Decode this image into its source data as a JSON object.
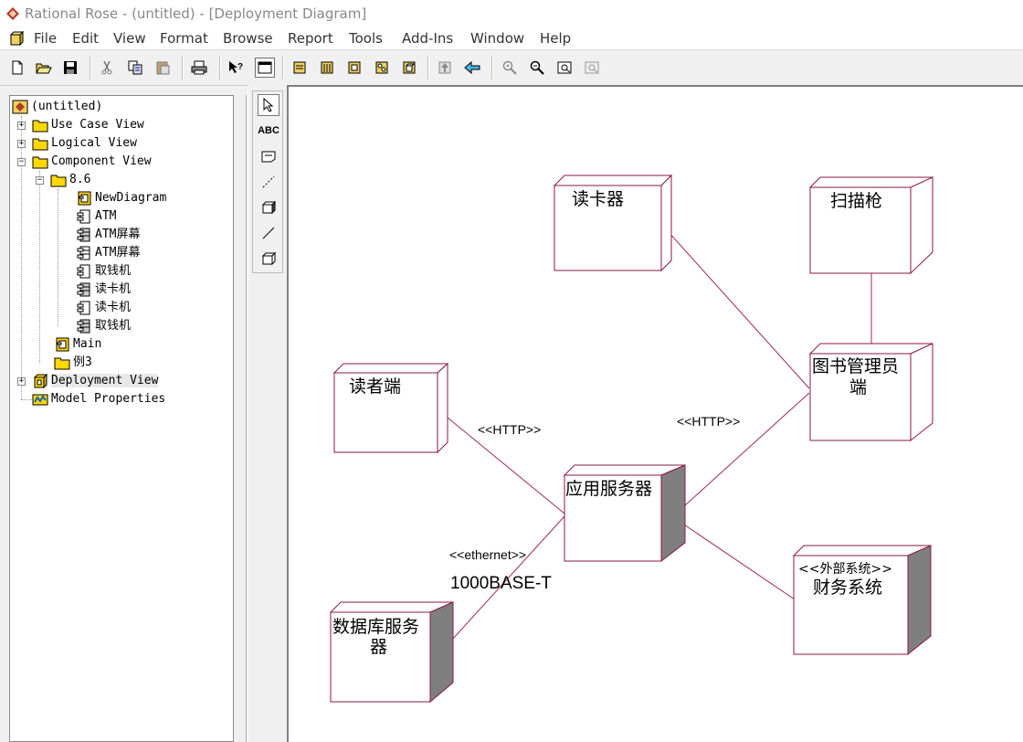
{
  "window": {
    "title": "Rational Rose - (untitled) - [Deployment Diagram]"
  },
  "menu": [
    "File",
    "Edit",
    "View",
    "Format",
    "Browse",
    "Report",
    "Tools",
    "Add-Ins",
    "Window",
    "Help"
  ],
  "browser": {
    "root": "(untitled)",
    "use_case_view": "Use Case View",
    "logical_view": "Logical View",
    "component_view": "Component View",
    "package_86": "8.6",
    "new_diagram": "NewDiagram",
    "comp_atm": "ATM",
    "comp_atm_screen_1": "ATM屏幕",
    "comp_atm_screen_2": "ATM屏幕",
    "comp_withdraw_1": "取钱机",
    "comp_card_reader_1": "读卡机",
    "comp_card_reader_2": "读卡机",
    "comp_withdraw_2": "取钱机",
    "main": "Main",
    "example3": "例3",
    "deployment_view": "Deployment View",
    "model_properties": "Model Properties"
  },
  "palette": {
    "text_tool": "ABC"
  },
  "diagram": {
    "nodes": {
      "card_reader": "读卡器",
      "scanner": "扫描枪",
      "reader_client_line1": "读者端",
      "librarian_line1": "图书管理员",
      "librarian_line2": "端",
      "app_server": "应用服务器",
      "db_server_line1": "数据库服务",
      "db_server_line2": "器",
      "finance_stereotype": "<<外部系统>>",
      "finance": "财务系统"
    },
    "connections": {
      "http_left": "<<HTTP>>",
      "http_right": "<<HTTP>>",
      "ethernet": "<<ethernet>>",
      "ethernet_spec": "1000BASE-T"
    }
  },
  "colors": {
    "node_border": "#8b1a3c",
    "connector": "#a0284e",
    "processor_fill": "#7f7f7f"
  }
}
